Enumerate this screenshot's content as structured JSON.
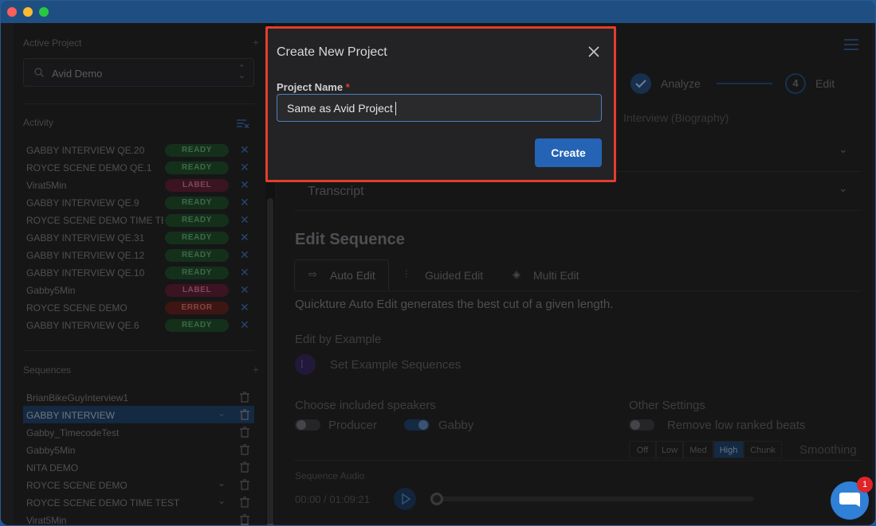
{
  "sidebar": {
    "active_project_label": "Active Project",
    "active_project_value": "Avid Demo",
    "activity_label": "Activity",
    "sequences_label": "Sequences",
    "plus": "+",
    "activity": [
      {
        "name": "GABBY INTERVIEW QE.20",
        "status": "READY"
      },
      {
        "name": "ROYCE SCENE DEMO QE.1",
        "status": "READY"
      },
      {
        "name": "Virat5Min",
        "status": "LABEL"
      },
      {
        "name": "GABBY INTERVIEW QE.9",
        "status": "READY"
      },
      {
        "name": "ROYCE SCENE DEMO TIME TE",
        "status": "READY"
      },
      {
        "name": "GABBY INTERVIEW QE.31",
        "status": "READY"
      },
      {
        "name": "GABBY INTERVIEW QE.12",
        "status": "READY"
      },
      {
        "name": "GABBY INTERVIEW QE.10",
        "status": "READY"
      },
      {
        "name": "Gabby5Min",
        "status": "LABEL"
      },
      {
        "name": "ROYCE SCENE DEMO",
        "status": "ERROR"
      },
      {
        "name": "GABBY INTERVIEW QE.6",
        "status": "READY"
      }
    ],
    "sequences": [
      {
        "name": "BrianBikeGuyInterview1"
      },
      {
        "name": "GABBY INTERVIEW"
      },
      {
        "name": "Gabby_TimecodeTest"
      },
      {
        "name": "Gabby5Min"
      },
      {
        "name": "NITA DEMO"
      },
      {
        "name": "ROYCE SCENE DEMO"
      },
      {
        "name": "ROYCE SCENE DEMO TIME TEST"
      },
      {
        "name": "Virat5Min"
      }
    ]
  },
  "main": {
    "steps": {
      "step3_label": "Analyze",
      "step4_number": "4",
      "step4_label": "Edit"
    },
    "interview_title": "Interview (Biography)",
    "transcript": "Transcript",
    "edit_sequence_title": "Edit Sequence",
    "tabs": {
      "auto": "Auto Edit",
      "guided": "Guided Edit",
      "multi": "Multi Edit"
    },
    "description": "Quickture Auto Edit generates the best cut of a given length.",
    "edit_by_example": "Edit by Example",
    "set_example": "Set Example Sequences",
    "speakers_title": "Choose included speakers",
    "speaker1": "Producer",
    "speaker2": "Gabby",
    "other_settings": "Other Settings",
    "remove_low": "Remove low ranked beats",
    "seg": {
      "off": "Off",
      "low": "Low",
      "med": "Med",
      "high": "High",
      "chunk": "Chunk"
    },
    "smoothing": "Smoothing",
    "sequence_audio": "Sequence Audio",
    "timecode": "00:00 / 01:09:21"
  },
  "modal": {
    "title": "Create New Project",
    "field_label": "Project Name",
    "required_mark": "*",
    "field_value": "Same as Avid Project",
    "create_label": "Create"
  },
  "chat": {
    "badge_count": "1"
  },
  "colors": {
    "accent": "#2563b5",
    "highlight_border": "#e43d2c",
    "ready": "#5fa46c",
    "label": "#c07088",
    "error": "#cf6a62"
  }
}
